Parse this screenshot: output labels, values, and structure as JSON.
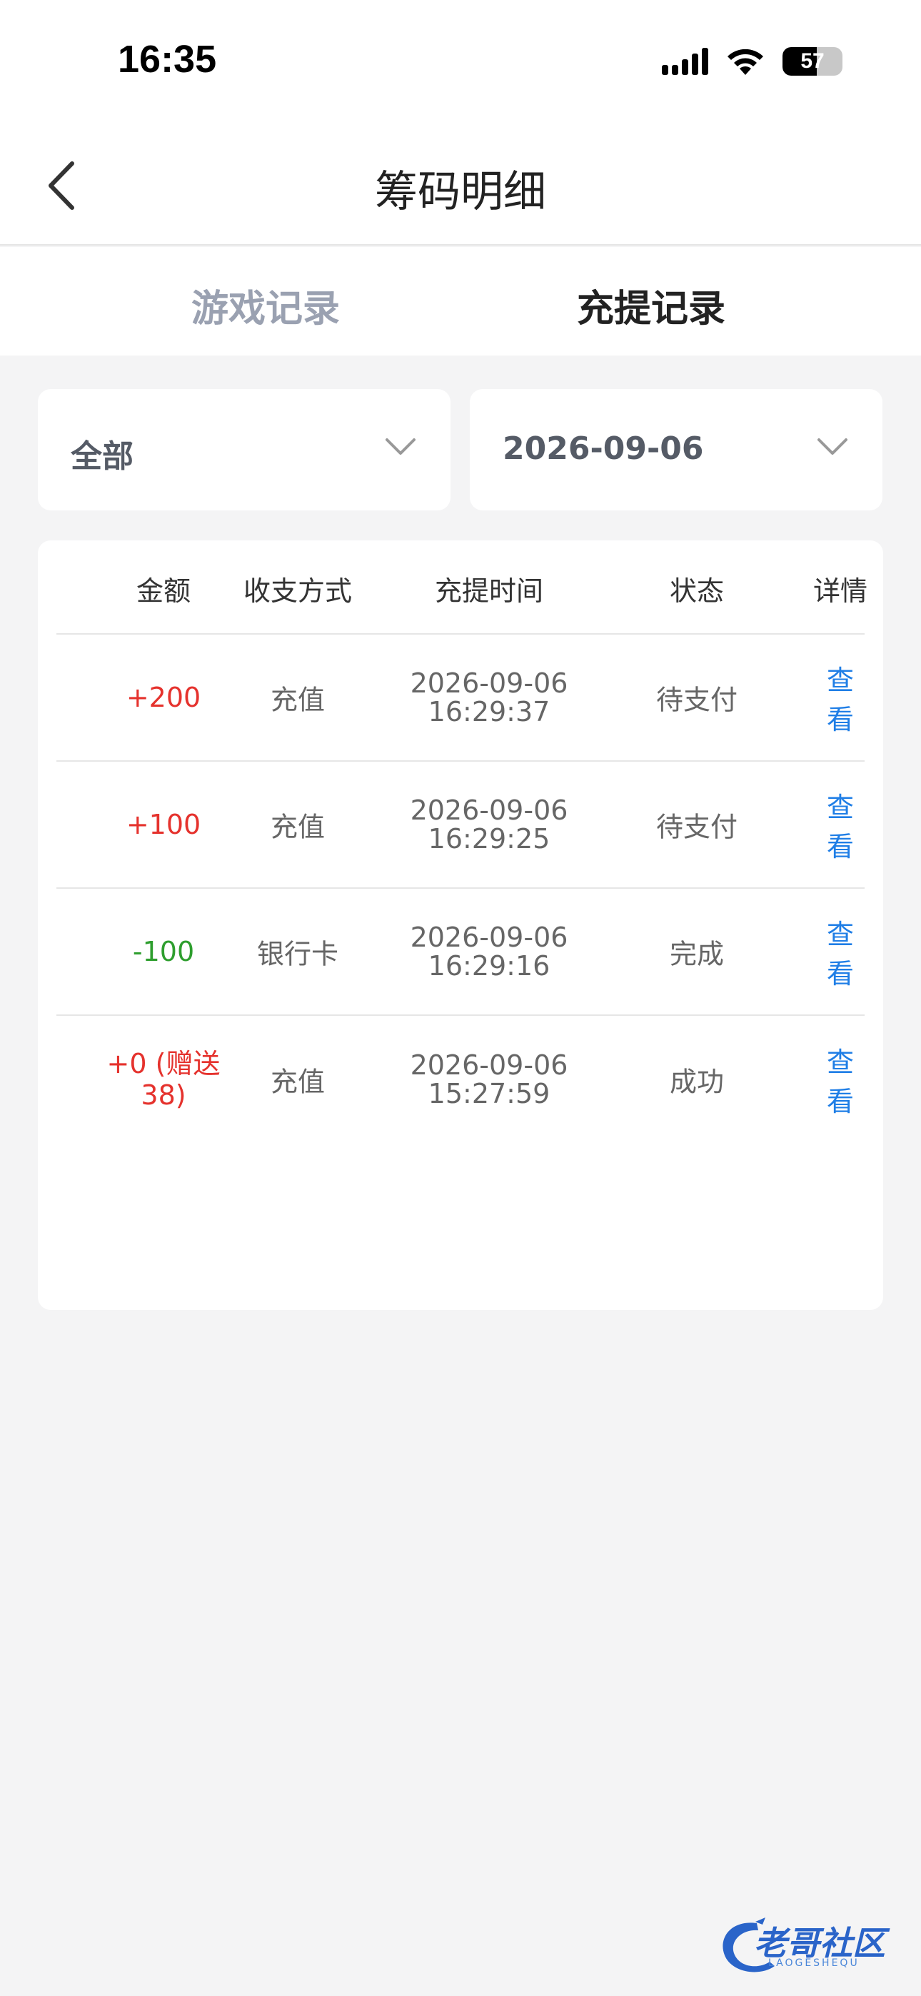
{
  "status_bar": {
    "time": "16:35",
    "battery": "57"
  },
  "header": {
    "title": "筹码明细"
  },
  "tabs": [
    {
      "label": "游戏记录",
      "active": false
    },
    {
      "label": "充提记录",
      "active": true
    }
  ],
  "filters": {
    "type": "全部",
    "date": "2026-09-06"
  },
  "table": {
    "columns": [
      "金额",
      "收支方式",
      "充提时间",
      "状态",
      "详情"
    ],
    "rows": [
      {
        "amount": "+200",
        "method": "充值",
        "date": "2026-09-06",
        "time": "16:29:37",
        "status": "待支付",
        "detail": "查看"
      },
      {
        "amount": "+100",
        "method": "充值",
        "date": "2026-09-06",
        "time": "16:29:25",
        "status": "待支付",
        "detail": "查看"
      },
      {
        "amount": "-100",
        "method": "银行卡",
        "date": "2026-09-06",
        "time": "16:29:16",
        "status": "完成",
        "detail": "查看"
      },
      {
        "amount_line1": "+0 (赠送",
        "amount_line2": "38)",
        "method": "充值",
        "date": "2026-09-06",
        "time": "15:27:59",
        "status": "成功",
        "detail": "查看"
      }
    ]
  },
  "watermark": {
    "text": "老哥社区",
    "sub": "LAOGESHEQU"
  },
  "colors": {
    "positive": "#e5322d",
    "negative": "#2e9e2e",
    "link": "#1f7ee6",
    "tab_inactive": "#9aa1b1"
  }
}
